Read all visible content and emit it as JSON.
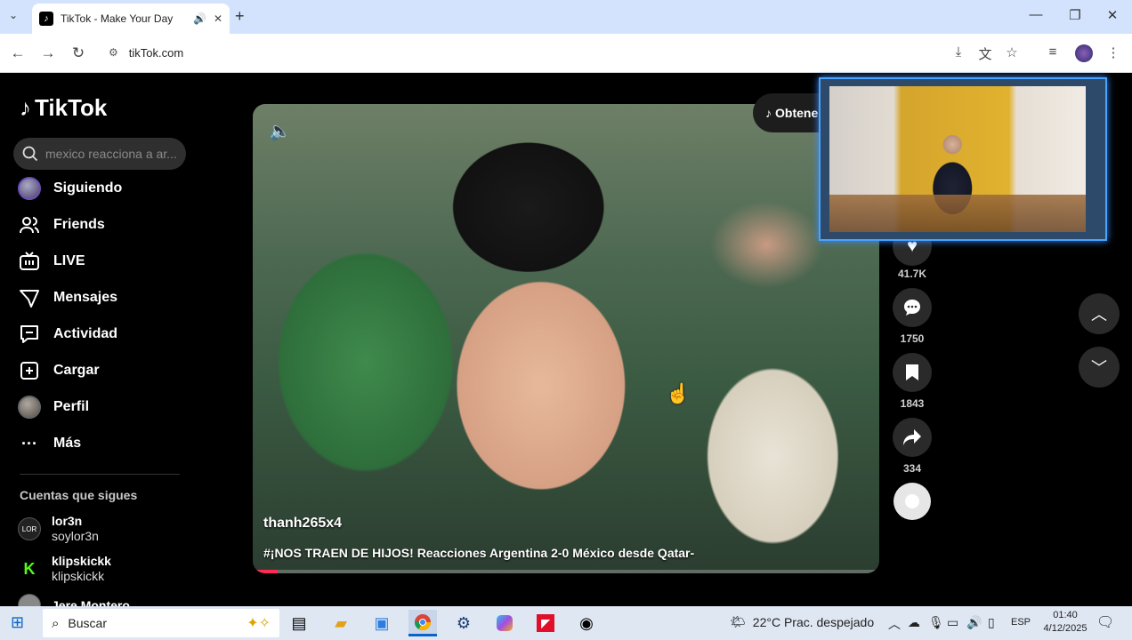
{
  "browser": {
    "tab_title": "TikTok - Make Your Day",
    "url": "tikTok.com"
  },
  "sidebar": {
    "logo": "TikTok",
    "search_placeholder": "mexico reacciona a ar...",
    "items": [
      {
        "label": "Siguiendo",
        "icon": "following-avatar-icon"
      },
      {
        "label": "Friends",
        "icon": "friends-icon"
      },
      {
        "label": "LIVE",
        "icon": "live-icon"
      },
      {
        "label": "Mensajes",
        "icon": "messages-icon"
      },
      {
        "label": "Actividad",
        "icon": "activity-icon"
      },
      {
        "label": "Cargar",
        "icon": "upload-icon"
      },
      {
        "label": "Perfil",
        "icon": "profile-avatar-icon"
      },
      {
        "label": "Más",
        "icon": "more-icon"
      }
    ],
    "following_header": "Cuentas que sigues",
    "accounts": [
      {
        "name": "lor3n",
        "username": "soylor3n"
      },
      {
        "name": "klipskickk",
        "username": "klipskickk"
      },
      {
        "name": "Jere Montero",
        "username": ""
      }
    ]
  },
  "video": {
    "author": "thanh265x4",
    "caption": "#¡NOS TRAEN DE HIJOS! Reacciones Argentina 2-0 México desde Qatar-",
    "get_app_label": "Obtener",
    "progress": 0.04
  },
  "actions": {
    "likes": "41.7K",
    "comments": "1750",
    "saves": "1843",
    "shares": "334"
  },
  "taskbar": {
    "search_label": "Buscar",
    "weather": "22°C  Prac. despejado",
    "language": "ESP",
    "time": "01:40",
    "date": "4/12/2025"
  }
}
